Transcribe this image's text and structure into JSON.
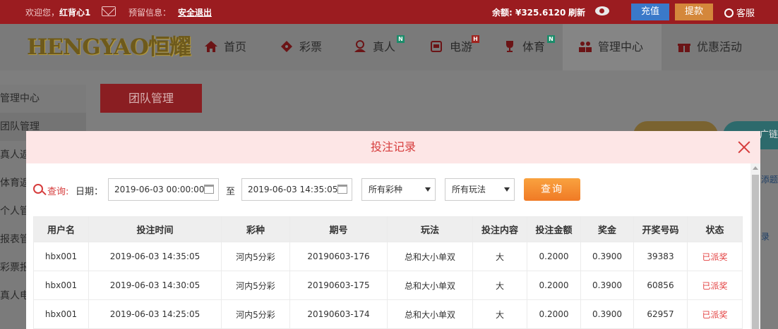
{
  "topbar": {
    "welcome": "欢迎您，",
    "username": "红背心1",
    "reserve_label": "预留信息：",
    "logout": "安全退出",
    "balance_label": "余额: ",
    "balance_value": "¥325.6120",
    "refresh": "刷新",
    "recharge": "充值",
    "withdraw": "提款",
    "customer_service": "客服"
  },
  "brand": {
    "logo_text": "HENGYAO恒耀"
  },
  "nav": [
    {
      "label": "首页",
      "icon": "home-icon"
    },
    {
      "label": "彩票",
      "icon": "ticket-icon"
    },
    {
      "label": "真人",
      "icon": "dealer-icon",
      "badge": "N"
    },
    {
      "label": "电游",
      "icon": "slot-icon",
      "badge": "H"
    },
    {
      "label": "体育",
      "icon": "trophy-icon",
      "badge": "N"
    },
    {
      "label": "管理中心",
      "icon": "users-icon"
    },
    {
      "label": "优惠活动",
      "icon": "gift-icon"
    }
  ],
  "sidebar": [
    "管理中心",
    "团队管理",
    "真人返",
    "体育返",
    "个人管",
    "报表管",
    "彩票报",
    "真人电"
  ],
  "page": {
    "tab": "团队管理",
    "bg_pill2_text": "广链",
    "bg_text1": "添题",
    "bg_text2": "录"
  },
  "colors": {
    "accent": "#d63c3c",
    "topbar": "#b22025",
    "button_orange": "#f07a25"
  },
  "modal": {
    "title": "投注记录",
    "query_label": "查询:",
    "date_label": "日期：",
    "date_start": "2019-06-03 00:00:00",
    "to_label": "至",
    "date_end": "2019-06-03 14:35:05",
    "lottery_select": "所有彩种",
    "play_select": "所有玩法",
    "query_button": "查询",
    "table": {
      "headers": [
        "用户名",
        "投注时间",
        "彩种",
        "期号",
        "玩法",
        "投注内容",
        "投注金额",
        "奖金",
        "开奖号码",
        "状态"
      ],
      "rows": [
        [
          "hbx001",
          "2019-06-03 14:35:05",
          "河内5分彩",
          "20190603-176",
          "总和大小单双",
          "大",
          "0.2000",
          "0.3900",
          "39383",
          "已派奖"
        ],
        [
          "hbx001",
          "2019-06-03 14:30:05",
          "河内5分彩",
          "20190603-175",
          "总和大小单双",
          "大",
          "0.2000",
          "0.3900",
          "60856",
          "已派奖"
        ],
        [
          "hbx001",
          "2019-06-03 14:25:05",
          "河内5分彩",
          "20190603-174",
          "总和大小单双",
          "大",
          "0.2000",
          "0.3900",
          "62957",
          "已派奖"
        ]
      ]
    }
  }
}
